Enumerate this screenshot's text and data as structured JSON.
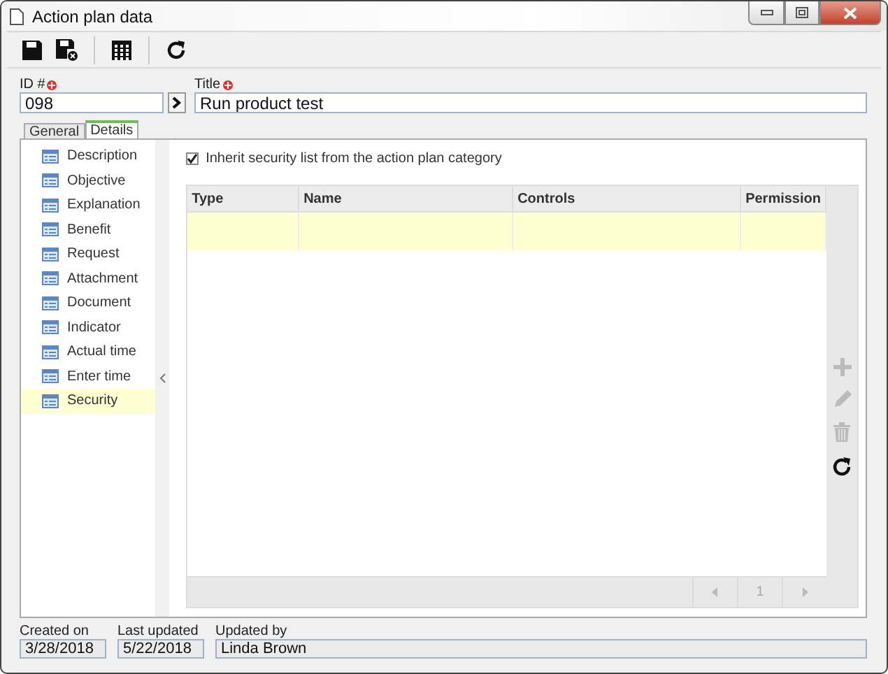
{
  "window": {
    "title": "Action plan data"
  },
  "toolbar": [
    {
      "kind": "save",
      "disabled": false
    },
    {
      "kind": "save-close",
      "disabled": false
    },
    {
      "kind": "separator"
    },
    {
      "kind": "grid",
      "disabled": false
    },
    {
      "kind": "separator"
    },
    {
      "kind": "refresh",
      "disabled": false
    }
  ],
  "header_fields": [
    {
      "label": "ID #",
      "required": true,
      "value": "098",
      "has_button": true
    },
    {
      "label": "Title",
      "required": true,
      "value": "Run product test",
      "has_button": false
    }
  ],
  "tabs": [
    {
      "label": "General",
      "selected": false
    },
    {
      "label": "Details",
      "selected": true
    }
  ],
  "sidebar": {
    "items": [
      {
        "label": "Description",
        "selected": false
      },
      {
        "label": "Objective",
        "selected": false
      },
      {
        "label": "Explanation",
        "selected": false
      },
      {
        "label": "Benefit",
        "selected": false
      },
      {
        "label": "Request",
        "selected": false
      },
      {
        "label": "Attachment",
        "selected": false
      },
      {
        "label": "Document",
        "selected": false
      },
      {
        "label": "Indicator",
        "selected": false
      },
      {
        "label": "Actual time",
        "selected": false
      },
      {
        "label": "Enter time",
        "selected": false
      },
      {
        "label": "Security",
        "selected": true
      }
    ]
  },
  "inherit_checkbox": {
    "label": "Inherit security list from the action plan category",
    "checked": true
  },
  "table": {
    "columns": [
      "Type",
      "Name",
      "Controls",
      "Permission"
    ],
    "pager": {
      "page": "1"
    }
  },
  "side_actions": [
    {
      "kind": "add",
      "disabled": true
    },
    {
      "kind": "edit",
      "disabled": true
    },
    {
      "kind": "delete",
      "disabled": true
    },
    {
      "kind": "refresh",
      "disabled": false
    }
  ],
  "footer": [
    {
      "label": "Created on",
      "value": "3/28/2018"
    },
    {
      "label": "Last updated",
      "value": "5/22/2018"
    },
    {
      "label": "Updated by",
      "value": "Linda Brown"
    }
  ]
}
